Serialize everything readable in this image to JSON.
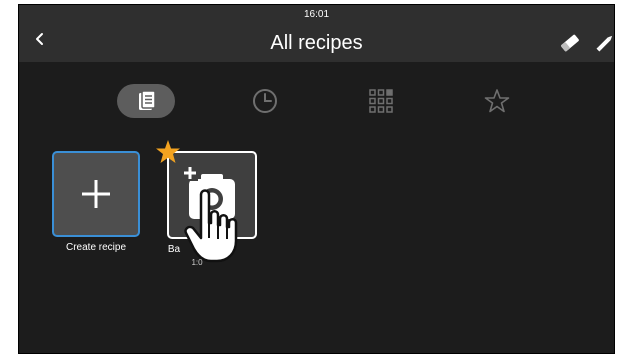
{
  "status_bar": {
    "time": "16:01"
  },
  "header": {
    "title": "All recipes"
  },
  "tiles": {
    "create": {
      "label": "Create recipe"
    },
    "basic": {
      "label": "Ba",
      "sub": "1:0"
    }
  },
  "colors": {
    "accent": "#3a8fd6",
    "favorite": "#f3a320"
  }
}
